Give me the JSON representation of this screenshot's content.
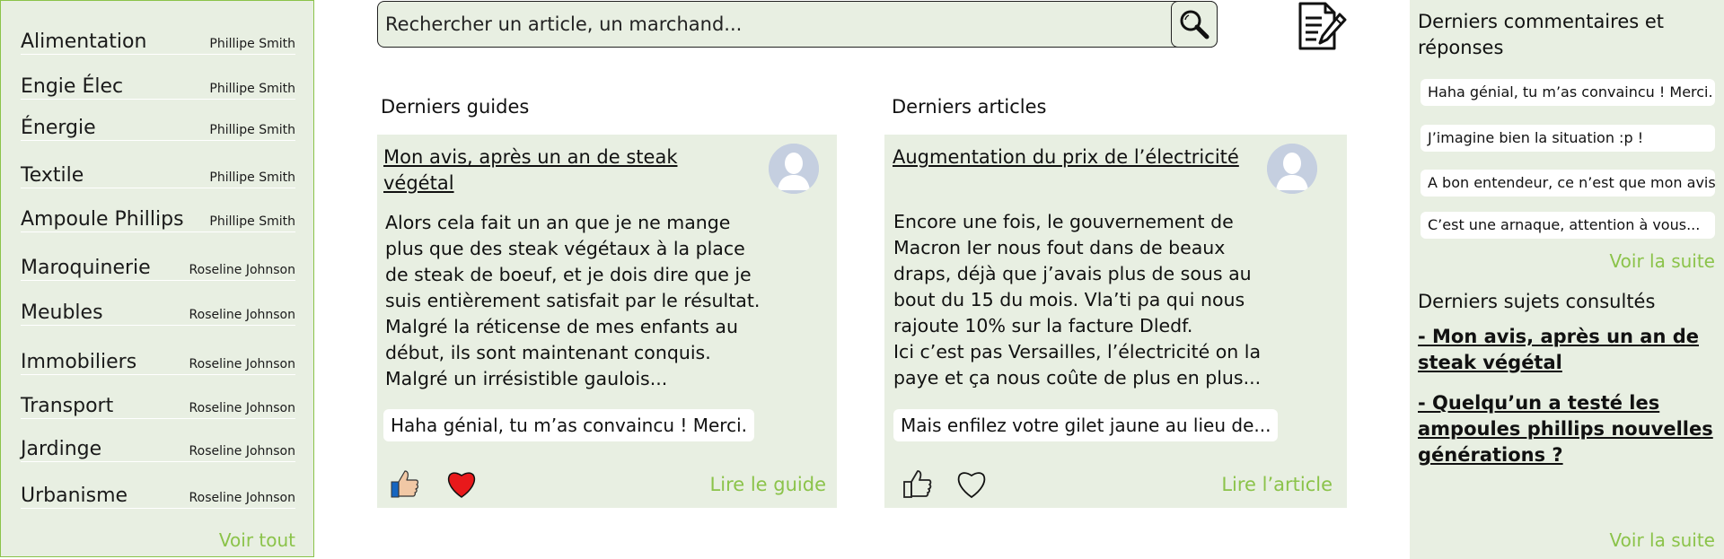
{
  "sidebar": {
    "items": [
      {
        "category": "Alimentation",
        "author": "Phillipe Smith"
      },
      {
        "category": "Engie Élec",
        "author": "Phillipe Smith"
      },
      {
        "category": "Énergie",
        "author": "Phillipe Smith"
      },
      {
        "category": "Textile",
        "author": "Phillipe Smith"
      },
      {
        "category": "Ampoule Phillips",
        "author": "Phillipe Smith"
      },
      {
        "category": "Maroquinerie",
        "author": "Roseline Johnson"
      },
      {
        "category": "Meubles",
        "author": "Roseline Johnson"
      },
      {
        "category": "Immobiliers",
        "author": "Roseline Johnson"
      },
      {
        "category": "Transport",
        "author": "Roseline Johnson"
      },
      {
        "category": "Jardinge",
        "author": "Roseline Johnson"
      },
      {
        "category": "Urbanisme",
        "author": "Roseline Johnson"
      }
    ],
    "see_all": "Voir tout"
  },
  "search": {
    "placeholder": "Rechercher un article, un marchand..."
  },
  "guides": {
    "section_title": "Derniers guides",
    "card": {
      "title": "Mon avis, après un an de steak végétal",
      "body": "Alors cela fait un an que je ne mange plus que des steak végétaux à la place de steak de boeuf, et je dois dire que je suis entièrement satisfait par le résultat. Malgré la réticense de mes enfants au début, ils sont maintenant conquis. Malgré un irrésistible gaulois...",
      "comment": "Haha génial, tu m’as convaincu ! Merci.",
      "link": "Lire le guide"
    }
  },
  "articles": {
    "section_title": "Derniers articles",
    "card": {
      "title": "Augmentation du prix de l’électricité",
      "body_line1": "Encore une fois, le gouvernement de Macron Ier nous fout dans de beaux draps, déjà que j’avais plus de sous au bout du 15 du mois. Vla’ti pa qui nous rajoute 10% sur la facture Dledf.",
      "body_line2": "Ici c’est pas Versailles, l’électricité on la paye et ça nous coûte de plus en plus...",
      "comment": "Mais enfilez votre gilet jaune au lieu de...",
      "link": "Lire l’article"
    }
  },
  "right_panel": {
    "comments_title": "Derniers commentaires et réponses",
    "comments": [
      "Haha génial, tu m’as convaincu ! Merci.",
      "J’imagine bien la situation :p !",
      "A bon entendeur, ce n’est que mon avis!",
      "C’est une arnaque, attention à vous..."
    ],
    "comments_more": "Voir la suite",
    "topics_title": "Derniers sujets consultés",
    "topics": [
      "- Mon avis, après un an de steak végétal",
      "- Quelqu’un a testé les ampoules phillips nouvelles générations ?"
    ],
    "topics_more": "Voir la suite"
  },
  "colors": {
    "accent": "#8bc34a",
    "panel_bg": "#e8efe2",
    "heart_filled": "#e8191b"
  }
}
